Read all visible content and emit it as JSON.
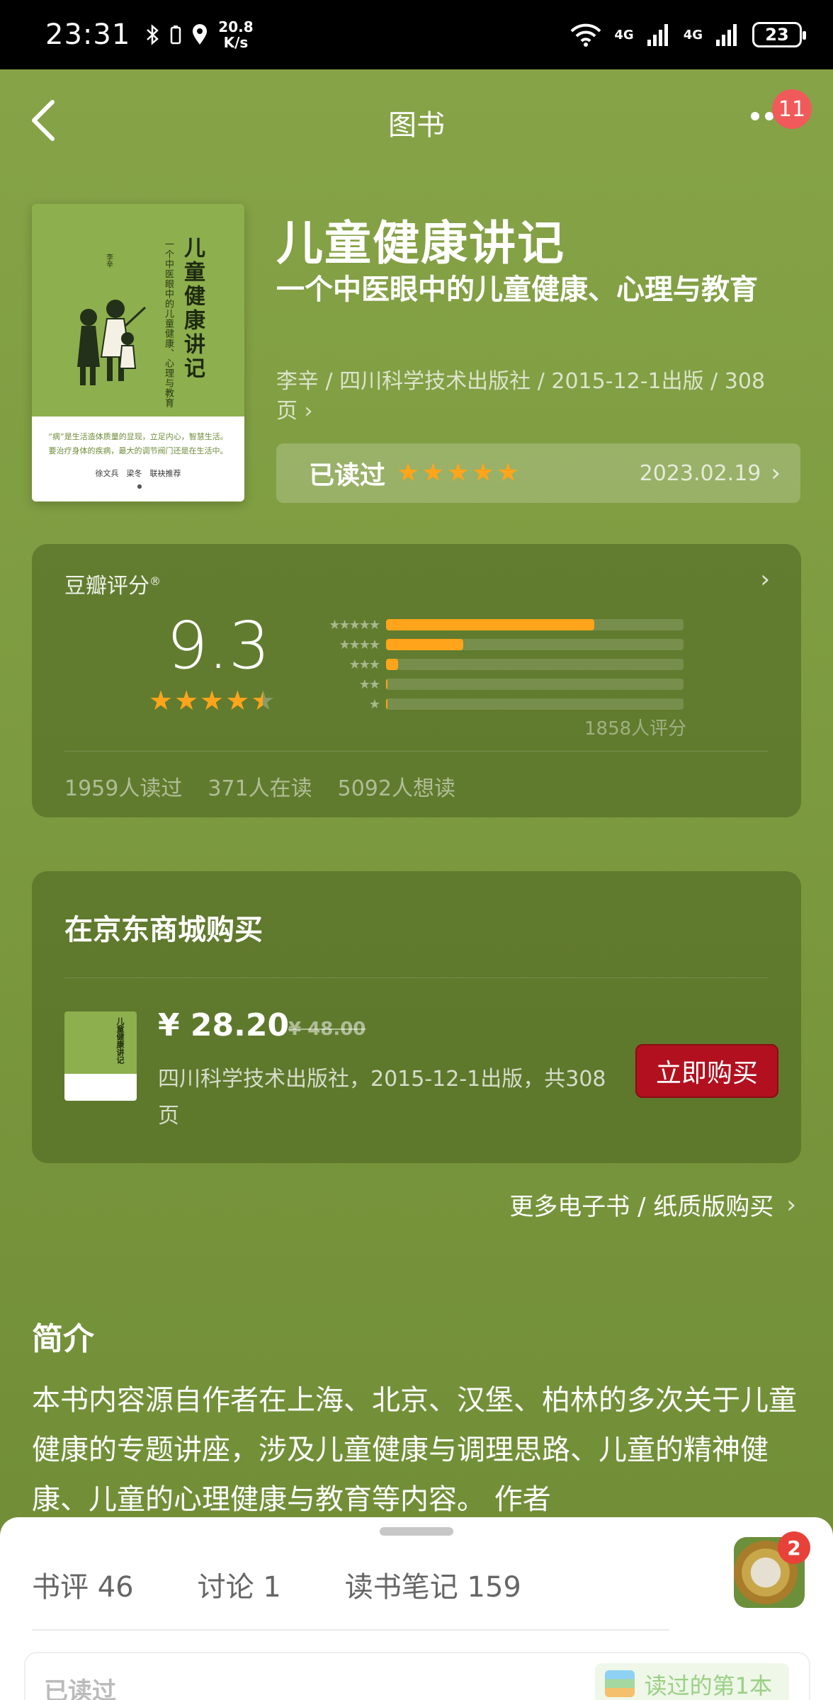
{
  "status_bar": {
    "time": "23:31",
    "speed_value": "20.8",
    "speed_unit": "K/s",
    "net1": "4G",
    "net2": "4G",
    "battery": "23"
  },
  "nav": {
    "title": "图书",
    "badge": "11"
  },
  "book": {
    "title": "儿童健康讲记",
    "subtitle": "一个中医眼中的儿童健康、心理与教育",
    "meta": "李辛 / 四川科学技术出版社 / 2015-12-1出版 / 308页",
    "cover": {
      "title": "儿童健康讲记",
      "subtitle": "一个中医眼中的儿童健康、心理与教育",
      "line1": "“病”是生活造体质量的显现，立足内心，智慧生活。",
      "line2": "要治疗身体的疾病，最大的调节阀门还是在生活中。",
      "authors": "徐文兵　梁冬　联袂推荐"
    },
    "read_status": "已读过",
    "user_rating": 5,
    "read_date": "2023.02.19"
  },
  "rating": {
    "title": "豆瓣评分",
    "score": "9.3",
    "stars": 4.5,
    "distribution": [
      0.7,
      0.26,
      0.04,
      0.005,
      0.005
    ],
    "count_text": "1858人评分",
    "read_count": "1959人读过",
    "reading_count": "371人在读",
    "want_count": "5092人想读"
  },
  "jd": {
    "title": "在京东商城购买",
    "price": "¥ 28.20",
    "old_price": "¥ 48.00",
    "desc": "四川科学技术出版社，2015-12-1出版，共308页",
    "buy_label": "立即购买",
    "more_link": "更多电子书 / 纸质版购买"
  },
  "intro": {
    "title": "简介",
    "text": "本书内容源自作者在上海、北京、汉堡、柏林的多次关于儿童健康的专题讲座，涉及儿童健康与调理思路、儿童的精神健康、儿童的心理健康与教育等内容。 作者"
  },
  "sheet": {
    "tabs": [
      "书评 46",
      "讨论 1",
      "读书笔记 159"
    ],
    "avatar_badge": "2",
    "card_left": "已读过",
    "card_right": "读过的第1本"
  },
  "colors": {
    "background": "#7c9a3f",
    "star": "#ffa41b",
    "buy_button": "#b2101e",
    "badge": "#f05a5a"
  },
  "icons": [
    "back-arrow-icon",
    "more-dots-icon",
    "chevron-right-icon",
    "star-icon",
    "wifi-icon",
    "signal-icon",
    "battery-icon",
    "bluetooth-icon",
    "location-icon"
  ]
}
